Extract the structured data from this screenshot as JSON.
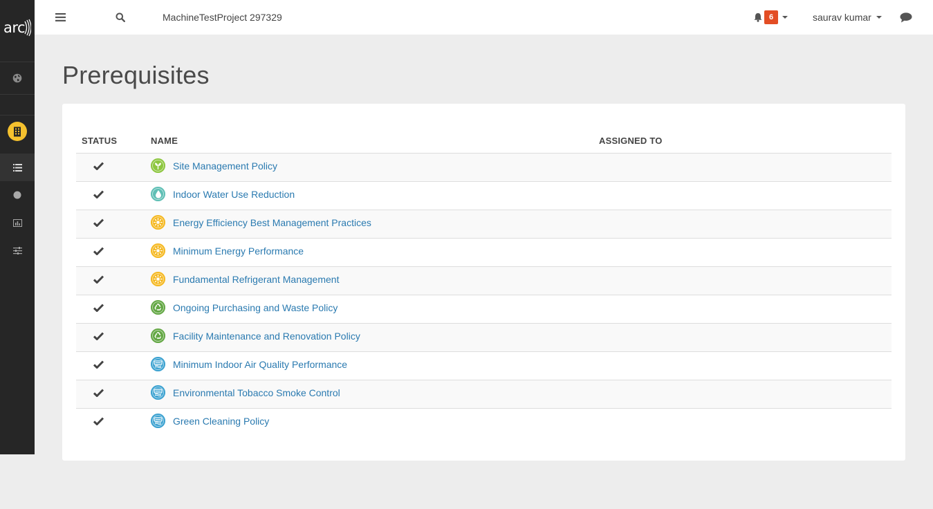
{
  "sidebar": {
    "logo_text": "arc",
    "items": [
      {
        "icon": "globe-icon"
      },
      {
        "icon": "building-icon",
        "accent": "#f5c12e"
      },
      {
        "icon": "list-icon"
      },
      {
        "icon": "circle-icon"
      },
      {
        "icon": "bar-chart-icon"
      },
      {
        "icon": "sliders-icon"
      }
    ]
  },
  "topbar": {
    "menu_icon": "hamburger-icon",
    "search_icon": "search-icon",
    "project_title": "MachineTestProject 297329",
    "notification_count": "6",
    "user_name": "saurav kumar",
    "chat_icon": "chat-icon"
  },
  "page": {
    "title": "Prerequisites"
  },
  "table": {
    "headers": {
      "status": "STATUS",
      "name": "NAME",
      "assigned": "ASSIGNED TO"
    },
    "rows": [
      {
        "name": "Site Management Policy",
        "category": "site",
        "color": "#8dc63f",
        "assigned": ""
      },
      {
        "name": "Indoor Water Use Reduction",
        "category": "water",
        "color": "#5fbfb5",
        "assigned": ""
      },
      {
        "name": "Energy Efficiency Best Management Practices",
        "category": "energy",
        "color": "#f5b820",
        "assigned": ""
      },
      {
        "name": "Minimum Energy Performance",
        "category": "energy",
        "color": "#f5b820",
        "assigned": ""
      },
      {
        "name": "Fundamental Refrigerant Management",
        "category": "energy",
        "color": "#f5b820",
        "assigned": ""
      },
      {
        "name": "Ongoing Purchasing and Waste Policy",
        "category": "materials",
        "color": "#63a744",
        "assigned": ""
      },
      {
        "name": "Facility Maintenance and Renovation Policy",
        "category": "materials",
        "color": "#63a744",
        "assigned": ""
      },
      {
        "name": "Minimum Indoor Air Quality Performance",
        "category": "indoor",
        "color": "#3aa1d0",
        "assigned": ""
      },
      {
        "name": "Environmental Tobacco Smoke Control",
        "category": "indoor",
        "color": "#3aa1d0",
        "assigned": ""
      },
      {
        "name": "Green Cleaning Policy",
        "category": "indoor",
        "color": "#3aa1d0",
        "assigned": ""
      }
    ]
  }
}
